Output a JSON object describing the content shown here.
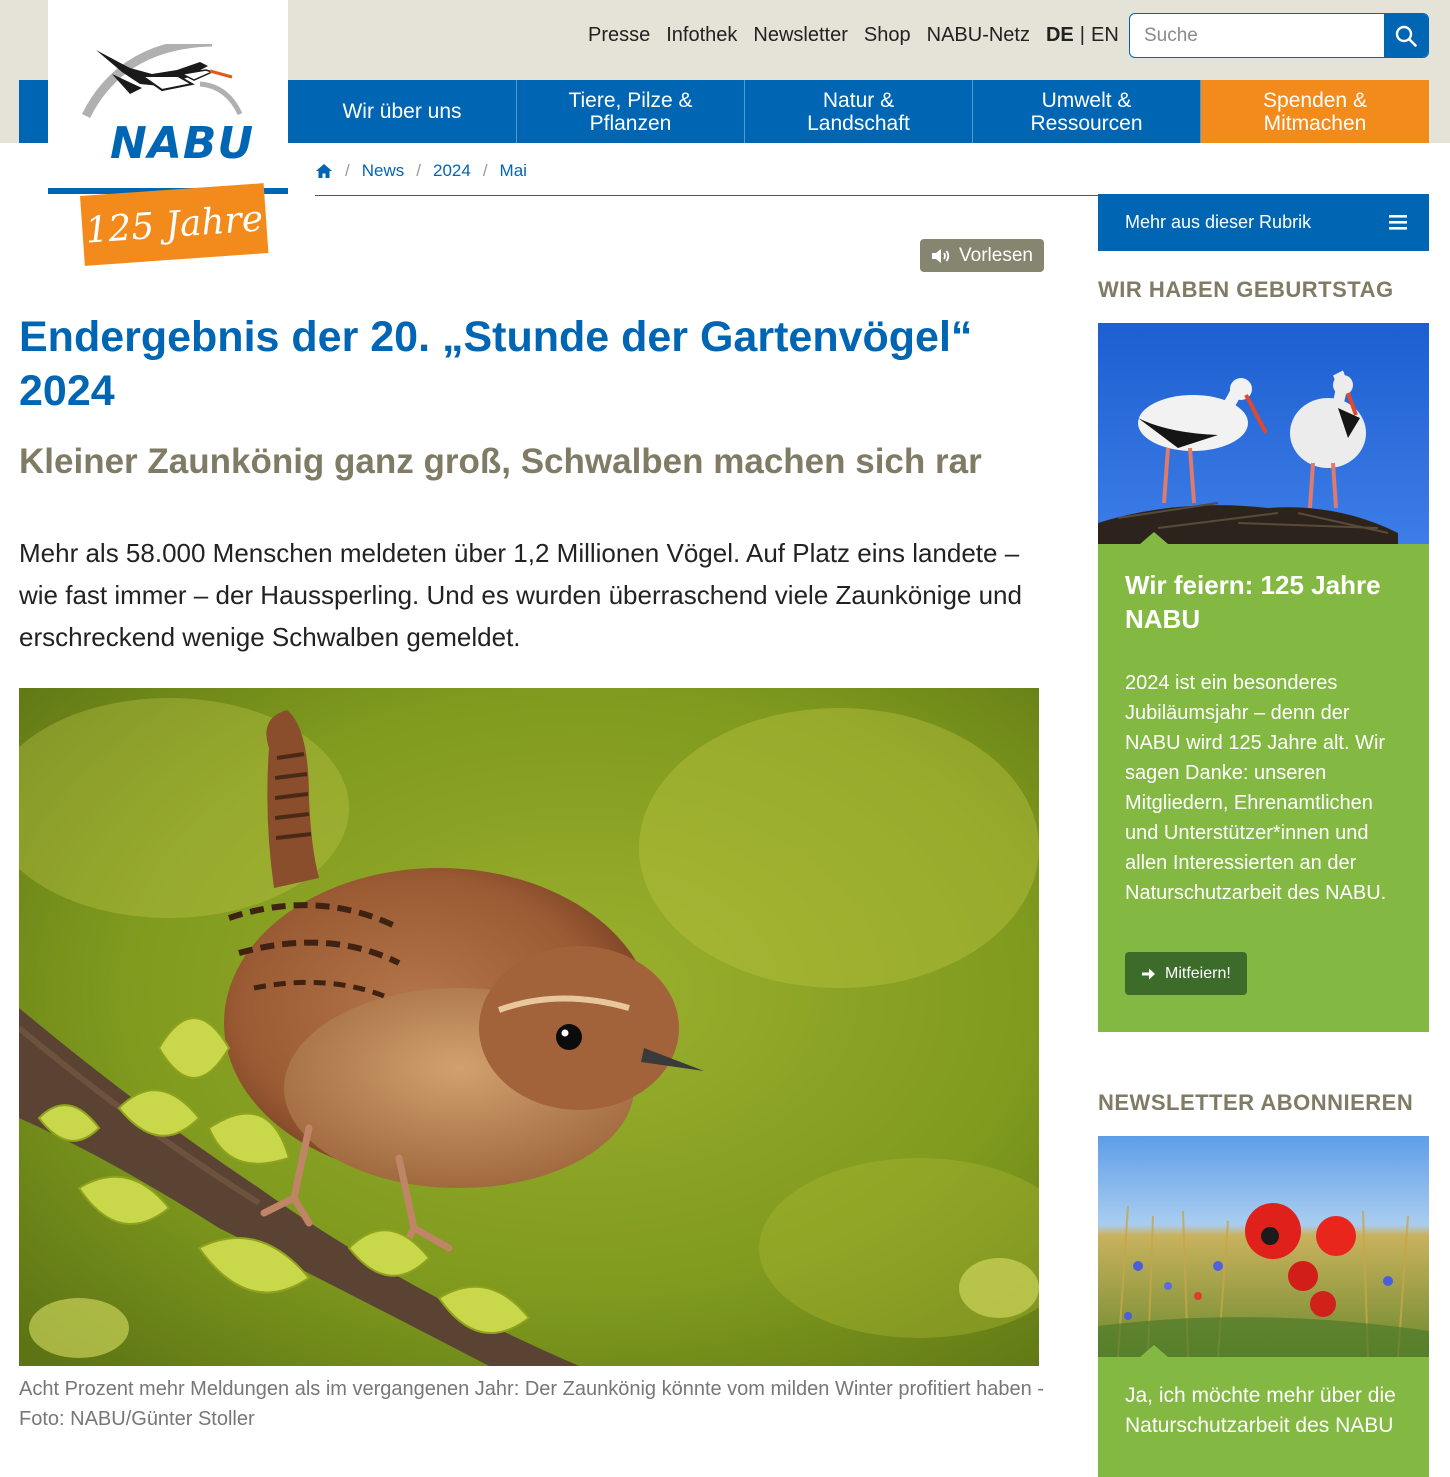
{
  "header": {
    "meta_links": [
      "Presse",
      "Infothek",
      "Newsletter",
      "Shop",
      "NABU-Netz"
    ],
    "lang_active": "DE",
    "lang_separator": "|",
    "lang_other": "EN",
    "search_placeholder": "Suche",
    "logo_text": "NABU",
    "anniversary_banner": "125 Jahre"
  },
  "nav": {
    "items": [
      {
        "line1": "Wir über uns",
        "line2": ""
      },
      {
        "line1": "Tiere, Pilze &",
        "line2": "Pflanzen"
      },
      {
        "line1": "Natur &",
        "line2": "Landschaft"
      },
      {
        "line1": "Umwelt &",
        "line2": "Ressourcen"
      },
      {
        "line1": "Spenden &",
        "line2": "Mitmachen"
      }
    ]
  },
  "breadcrumb": {
    "items": [
      "News",
      "2024",
      "Mai"
    ],
    "separator": "/"
  },
  "article": {
    "vorlesen_label": "Vorlesen",
    "title": "Endergebnis der 20. „Stunde der Gartenvögel“ 2024",
    "subtitle": "Kleiner Zaunkönig ganz groß, Schwalben machen sich rar",
    "intro": "Mehr als 58.000 Menschen meldeten über 1,2 Millionen Vögel. Auf Platz eins landete – wie fast immer – der Haussperling. Und es wurden überraschend viele Zaunkönige und erschreckend wenige Schwalben gemeldet.",
    "caption": "Acht Prozent mehr Meldungen als im vergangenen Jahr: Der Zaunkönig könnte vom milden Winter profitiert haben - Foto: NABU/Günter Stoller"
  },
  "sidebar": {
    "rubrik_label": "Mehr aus dieser Rubrik",
    "birthday_heading": "WIR HABEN GEBURTSTAG",
    "birthday_card_title": "Wir feiern: 125 Jahre NABU",
    "birthday_card_text": "2024 ist ein besonderes Jubiläumsjahr – denn der NABU wird 125 Jahre alt. Wir sagen Danke: unseren Mitgliedern, Ehrenamtlichen und Unterstützer*innen und allen Interessierten an der Naturschutzarbeit des NABU.",
    "birthday_button": "Mitfeiern!",
    "newsletter_heading": "NEWSLETTER ABONNIEREN",
    "newsletter_card_title": "Ja, ich möchte mehr über die Naturschutzarbeit des NABU"
  },
  "colors": {
    "brand_blue": "#0066b3",
    "accent_orange": "#f28a1c",
    "sidebar_green": "#83b942",
    "subtitle_olive": "#7f7b64",
    "topbar_beige": "#e5e2d7"
  },
  "icons": [
    "home-icon",
    "search-icon",
    "speaker-icon",
    "menu-icon",
    "arrow-right-icon",
    "stork-logo-icon"
  ]
}
